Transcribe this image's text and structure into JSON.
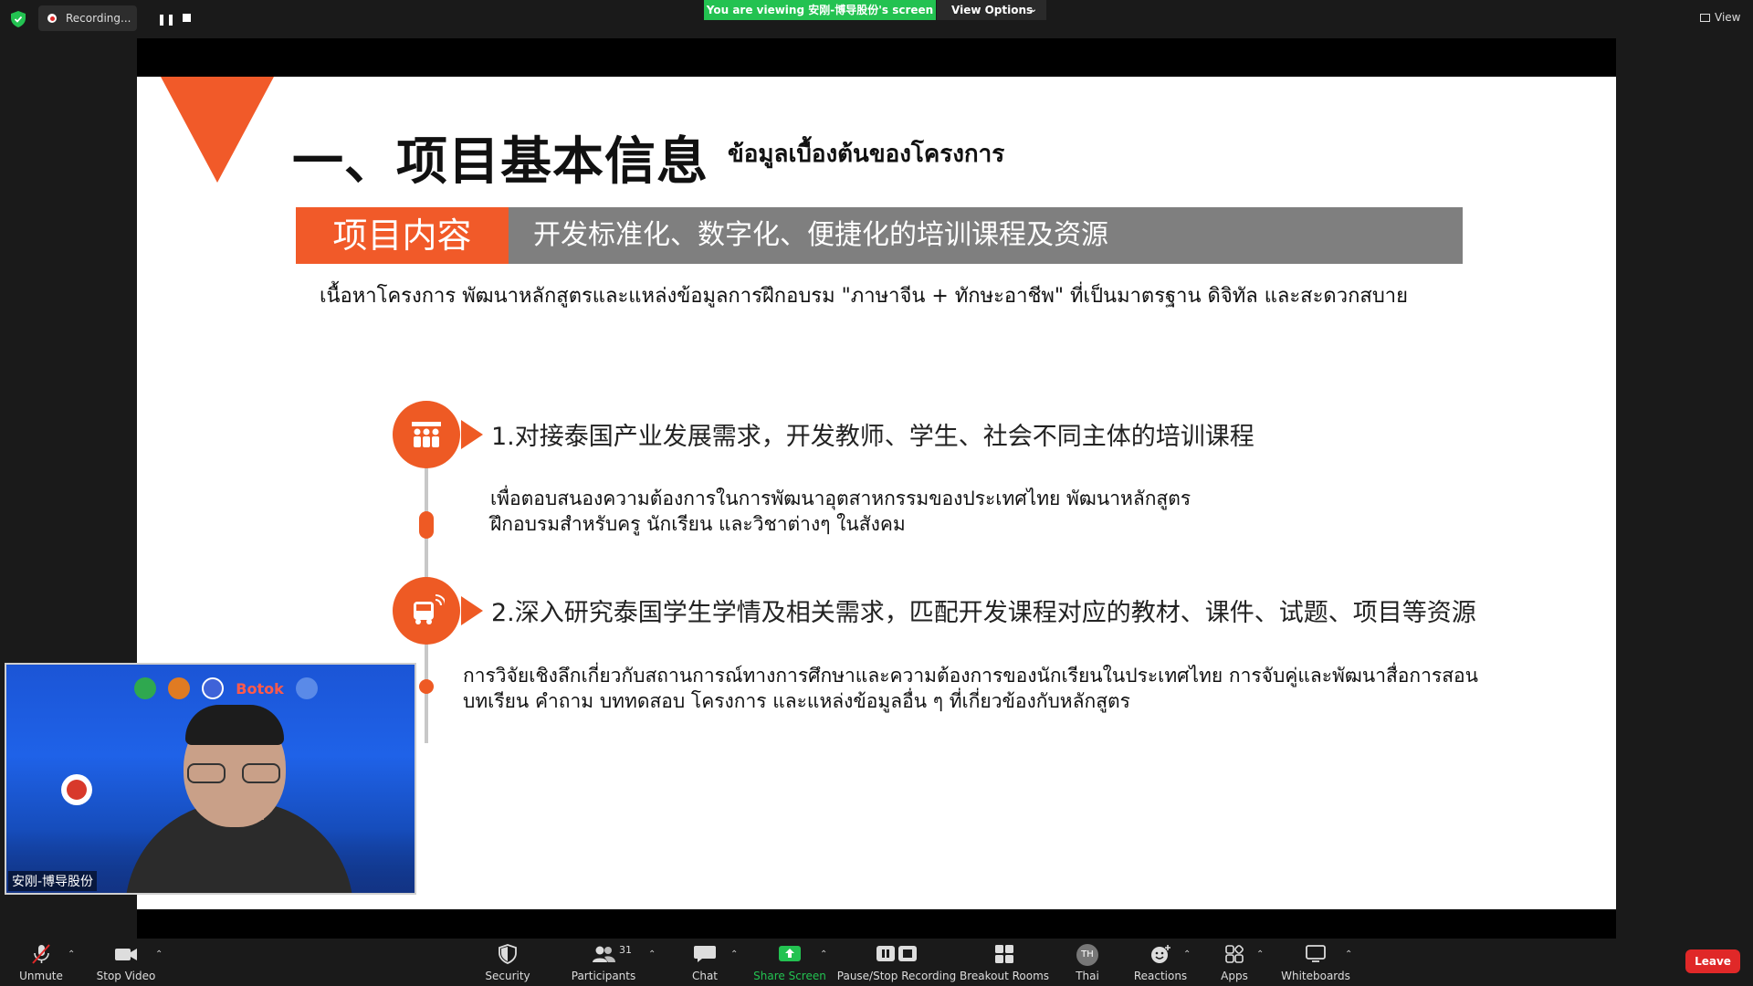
{
  "top_bar": {
    "recording_label": "Recording...",
    "viewing_banner": "You are viewing 安刚-博导股份's screen",
    "view_options_label": "View Options",
    "view_label": "View"
  },
  "slide": {
    "title": "一、项目基本信息",
    "subtitle": "ข้อมูลเบื้องต้นของโครงการ",
    "band_label": "项目内容",
    "band_text": "开发标准化、数字化、便捷化的培训课程及资源",
    "thai_intro": "เนื้อหาโครงการ  พัฒนาหลักสูตรและแหล่งข้อมูลการฝึกอบรม \"ภาษาจีน + ทักษะอาชีพ\" ที่เป็นมาตรฐาน ดิจิทัล และสะดวกสบาย",
    "items": [
      {
        "title": "1.对接泰国产业发展需求，开发教师、学生、社会不同主体的培训课程",
        "desc_line1": "เพื่อตอบสนองความต้องการในการพัฒนาอุตสาหกรรมของประเทศไทย พัฒนาหลักสูตร",
        "desc_line2": "ฝึกอบรมสำหรับครู นักเรียน และวิชาต่างๆ ในสังคม"
      },
      {
        "title": "2.深入研究泰国学生学情及相关需求，匹配开发课程对应的教材、课件、试题、项目等资源",
        "desc_line1": "การวิจัยเชิงลึกเกี่ยวกับสถานการณ์ทางการศึกษาและความต้องการของนักเรียนในประเทศไทย การจับคู่และพัฒนาสื่อการสอน",
        "desc_line2": "บทเรียน คำถาม  บททดสอบ โครงการ และแหล่งข้อมูลอื่น ๆ  ที่เกี่ยวข้องกับหลักสูตร"
      }
    ]
  },
  "video_tile": {
    "participant_name": "安刚-博导股份",
    "background_logo_text": "Botok"
  },
  "toolbar": {
    "unmute": "Unmute",
    "stop_video": "Stop Video",
    "security": "Security",
    "participants": "Participants",
    "participants_count": "31",
    "chat": "Chat",
    "share_screen": "Share Screen",
    "pause_stop_recording": "Pause/Stop Recording",
    "breakout_rooms": "Breakout Rooms",
    "thai_avatar": "TH",
    "thai": "Thai",
    "reactions": "Reactions",
    "apps": "Apps",
    "whiteboards": "Whiteboards",
    "leave": "Leave"
  },
  "colors": {
    "accent_orange": "#f15a29",
    "band_gray": "#7f7f7f",
    "share_green": "#23c251",
    "leave_red": "#e02828"
  }
}
